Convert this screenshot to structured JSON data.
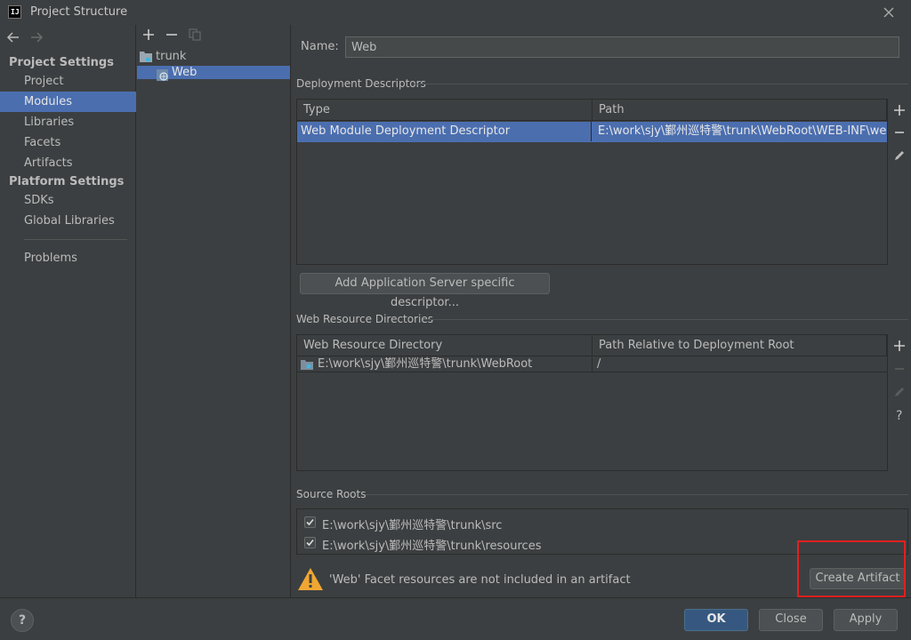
{
  "window": {
    "title": "Project Structure",
    "logo": "IJ"
  },
  "sidebar": {
    "project_settings_header": "Project Settings",
    "platform_settings_header": "Platform Settings",
    "items": [
      {
        "label": "Project"
      },
      {
        "label": "Modules",
        "selected": true
      },
      {
        "label": "Libraries"
      },
      {
        "label": "Facets"
      },
      {
        "label": "Artifacts"
      },
      {
        "label": "SDKs"
      },
      {
        "label": "Global Libraries"
      },
      {
        "label": "Problems"
      }
    ]
  },
  "tree": {
    "root": "trunk",
    "child": "Web"
  },
  "module": {
    "name_label": "Name:",
    "name_value": "Web"
  },
  "deployment": {
    "title": "Deployment Descriptors",
    "col_type": "Type",
    "col_path": "Path",
    "rows": [
      {
        "type": "Web Module Deployment Descriptor",
        "path": "E:\\work\\sjy\\鄞州巡特警\\trunk\\WebRoot\\WEB-INF\\web.xml"
      }
    ],
    "add_server_button": "Add Application Server specific descriptor..."
  },
  "web_resources": {
    "title": "Web Resource Directories",
    "col_dir": "Web Resource Directory",
    "col_rel": "Path Relative to Deployment Root",
    "rows": [
      {
        "dir": "E:\\work\\sjy\\鄞州巡特警\\trunk\\WebRoot",
        "rel": "/"
      }
    ]
  },
  "source_roots": {
    "title": "Source Roots",
    "items": [
      {
        "path": "E:\\work\\sjy\\鄞州巡特警\\trunk\\src",
        "checked": true
      },
      {
        "path": "E:\\work\\sjy\\鄞州巡特警\\trunk\\resources",
        "checked": true
      }
    ]
  },
  "warning": {
    "text": "'Web' Facet resources are not included in an artifact",
    "create_artifact_button": "Create Artifact"
  },
  "footer": {
    "help": "?",
    "ok": "OK",
    "close": "Close",
    "apply": "Apply"
  },
  "colors": {
    "background": "#3c3f41",
    "selection": "#4b6eaf",
    "primary_button": "#365880",
    "highlight_border": "#e02020",
    "warning_icon": "#f0a732"
  }
}
